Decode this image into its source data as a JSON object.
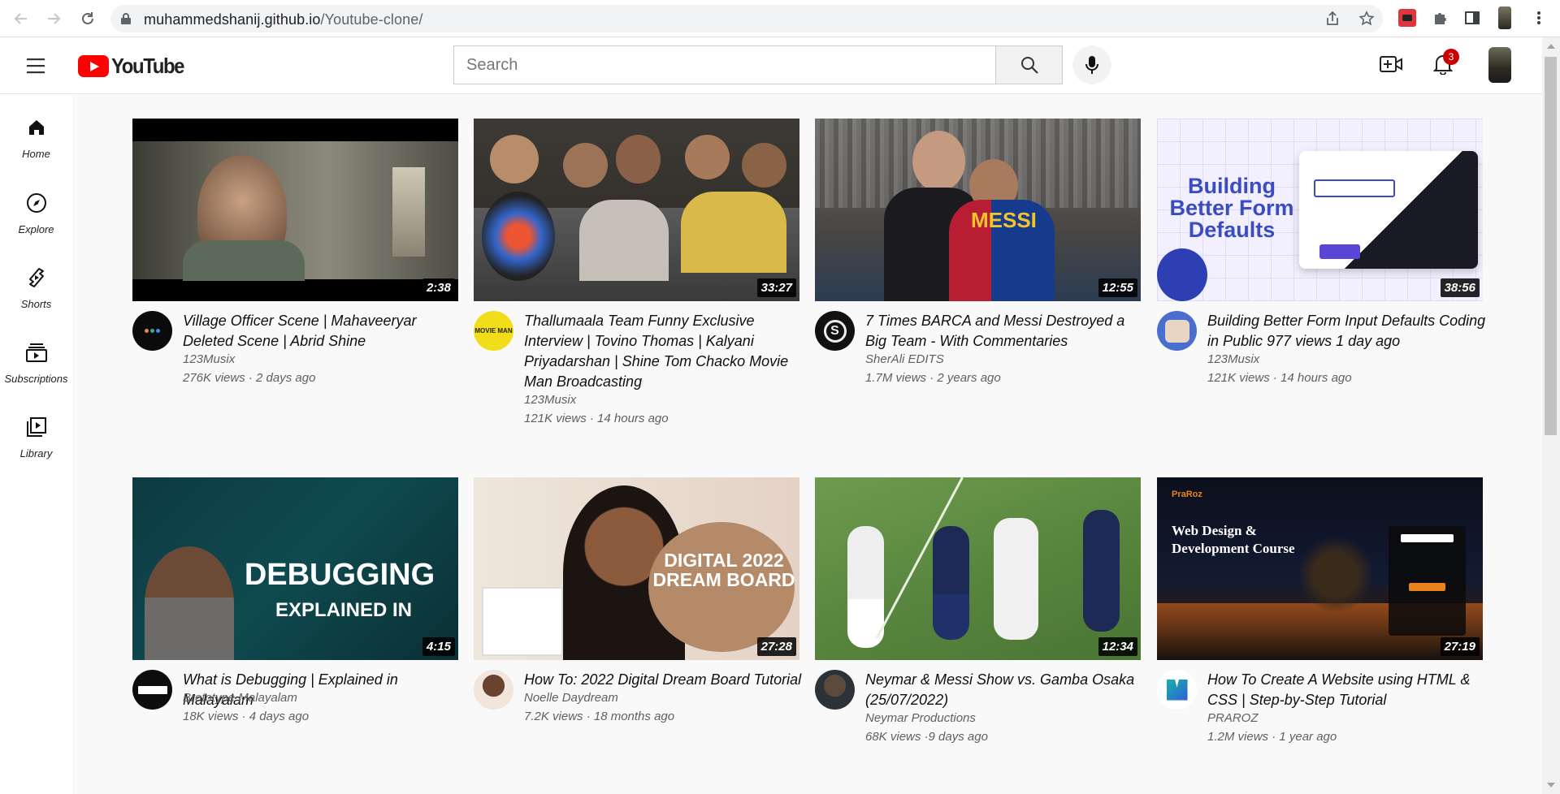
{
  "browser": {
    "url_host": "muhammedshanij.github.io",
    "url_path": "/Youtube-clone/"
  },
  "header": {
    "logo_text": "YouTube",
    "search_placeholder": "Search",
    "notification_count": "3"
  },
  "sidebar": {
    "items": [
      {
        "label": "Home",
        "icon": "home-icon"
      },
      {
        "label": "Explore",
        "icon": "compass-icon"
      },
      {
        "label": "Shorts",
        "icon": "shorts-icon"
      },
      {
        "label": "Subscriptions",
        "icon": "subscriptions-icon"
      },
      {
        "label": "Library",
        "icon": "library-icon"
      }
    ]
  },
  "videos": [
    {
      "title": "Village Officer Scene | Mahaveeryar Deleted Scene | Abrid Shine",
      "channel": "123Musix",
      "stats": "276K views · 2 days ago",
      "duration": "2:38",
      "thumb_text": ""
    },
    {
      "title": "Thallumaala Team Funny Exclusive Interview | Tovino Thomas | Kalyani Priyadarshan | Shine Tom Chacko Movie Man Broadcasting",
      "channel": "123Musix",
      "stats": "121K views · 14 hours ago",
      "duration": "33:27",
      "thumb_text": ""
    },
    {
      "title": "7 Times BARCA and Messi Destroyed a Big Team - With Commentaries",
      "channel": "SherAli EDITS",
      "stats": "1.7M views · 2 years ago",
      "duration": "12:55",
      "thumb_text": "MESSI"
    },
    {
      "title": "Building Better Form Input Defaults Coding in Public 977 views 1 day ago",
      "channel": "123Musix",
      "stats": "121K views · 14 hours ago",
      "duration": "38:56",
      "thumb_text": "Building Better Form Defaults"
    },
    {
      "title": "What is Debugging | Explained in Malayalam",
      "channel": "Brototype Malayalam",
      "stats": "18K views · 4 days ago",
      "duration": "4:15",
      "thumb_text": "DEBUGGING"
    },
    {
      "title": "How To: 2022 Digital Dream Board Tutorial",
      "channel": "Noelle Daydream",
      "stats": "7.2K views · 18 months ago",
      "duration": "27:28",
      "thumb_text": "DIGITAL 2022 DREAM BOARD"
    },
    {
      "title": "Neymar & Messi Show vs. Gamba Osaka (25/07/2022)",
      "channel": "Neymar Productions",
      "stats": "68K views ·9 days ago",
      "duration": "12:34",
      "thumb_text": ""
    },
    {
      "title": "How To Create A Website using HTML & CSS | Step-by-Step Tutorial",
      "channel": "PRAROZ",
      "stats": "1.2M views · 1 year ago",
      "duration": "27:19",
      "thumb_text": "Web Design & Development Course"
    }
  ],
  "colors": {
    "youtube_red": "#ff0000",
    "badge_red": "#cc0000",
    "page_bg": "#f9f9f9"
  }
}
